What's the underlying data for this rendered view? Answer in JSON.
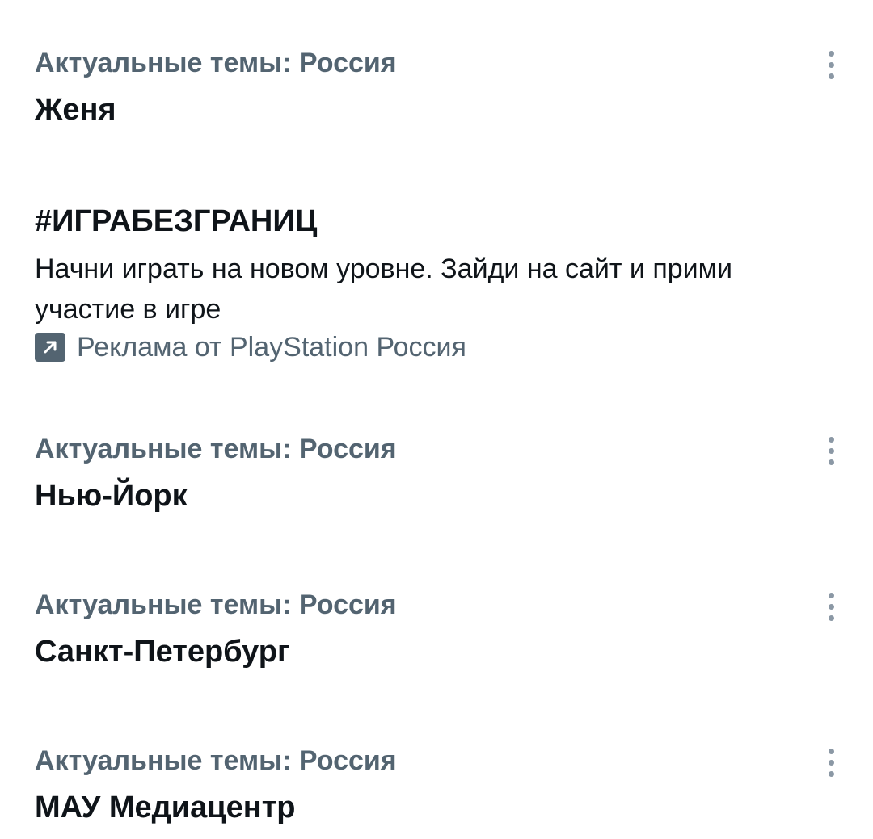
{
  "trends": [
    {
      "context": "Актуальные темы: Россия",
      "title": "Женя",
      "more_icon": "more-vertical-icon"
    },
    {
      "context": "Актуальные темы: Россия",
      "title": "Нью-Йорк",
      "more_icon": "more-vertical-icon"
    },
    {
      "context": "Актуальные темы: Россия",
      "title": "Санкт-Петербург",
      "more_icon": "more-vertical-icon"
    },
    {
      "context": "Актуальные темы: Россия",
      "title": "МАУ Медиацентр",
      "more_icon": "more-vertical-icon"
    }
  ],
  "ad": {
    "title": "#ИГРАБЕЗГРАНИЦ",
    "description": "Начни играть на новом уровне. Зайди на сайт и прими участие в игре",
    "promoted_text": "Реклама от PlayStation Россия",
    "promoted_icon": "promoted-arrow-icon"
  },
  "colors": {
    "primary_text": "#0f1419",
    "secondary_text": "#536471",
    "more_icon": "#8b98a5",
    "background": "#ffffff"
  }
}
